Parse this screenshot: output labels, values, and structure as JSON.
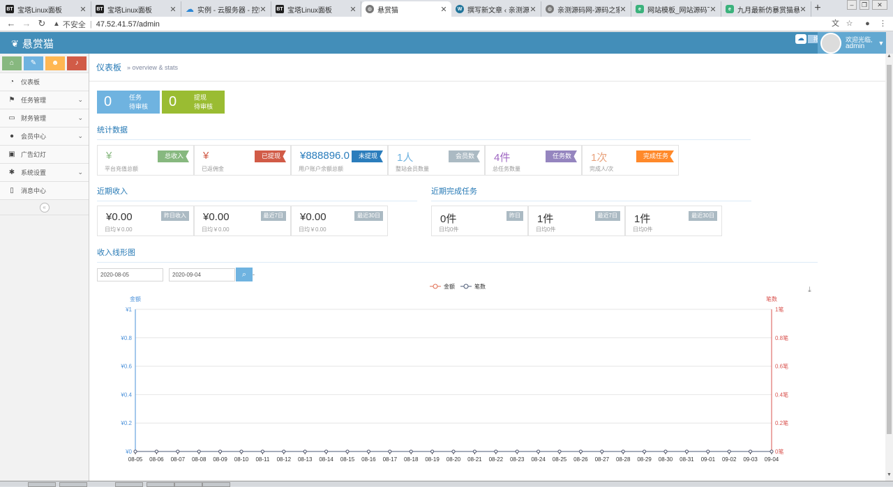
{
  "browser": {
    "tabs": [
      {
        "title": "宝塔Linux面板",
        "icon": "bt-icon"
      },
      {
        "title": "宝塔Linux面板",
        "icon": "bt-icon"
      },
      {
        "title": "实例 - 云服务器 - 控制台",
        "icon": "cloud-icon"
      },
      {
        "title": "宝塔Linux面板",
        "icon": "bt-icon"
      },
      {
        "title": "悬赏猫",
        "icon": "globe-icon"
      },
      {
        "title": "撰写新文章 ‹ 亲测源码网",
        "icon": "wordpress-icon"
      },
      {
        "title": "亲测源码网-源码之家",
        "icon": "globe-icon"
      },
      {
        "title": "网站模板_网站源码下载",
        "icon": "green-icon"
      },
      {
        "title": "九月最新仿暴赏猫悬赏",
        "icon": "green-icon"
      }
    ],
    "active_tab": 4,
    "address": {
      "insecure_label": "不安全",
      "url": "47.52.41.57/admin"
    }
  },
  "header": {
    "logo_text": "悬赏猫",
    "upload_label": "拖拽上传",
    "welcome": "欢迎光临,",
    "username": "admin"
  },
  "sidebar": {
    "shortcuts": [
      {
        "icon": "home-icon",
        "glyph": "⌂",
        "color": "#87b87f"
      },
      {
        "icon": "pencil-icon",
        "glyph": "✎",
        "color": "#6fb3e0"
      },
      {
        "icon": "users-icon",
        "glyph": "☻",
        "color": "#ffb752"
      },
      {
        "icon": "bell-icon",
        "glyph": "♪",
        "color": "#d15b47"
      }
    ],
    "items": [
      {
        "label": "仪表板",
        "icon": "dashboard-icon",
        "glyph": "◔",
        "chevron": false
      },
      {
        "label": "任务管理",
        "icon": "flag-icon",
        "glyph": "⚑",
        "chevron": true
      },
      {
        "label": "财务管理",
        "icon": "wallet-icon",
        "glyph": "▭",
        "chevron": true
      },
      {
        "label": "会员中心",
        "icon": "user-icon",
        "glyph": "●",
        "chevron": true
      },
      {
        "label": "广告幻灯",
        "icon": "picture-icon",
        "glyph": "▣",
        "chevron": false
      },
      {
        "label": "系统设置",
        "icon": "gear-icon",
        "glyph": "✱",
        "chevron": true
      },
      {
        "label": "消息中心",
        "icon": "bookmark-icon",
        "glyph": "▯",
        "chevron": false
      }
    ]
  },
  "breadcrumb": {
    "title": "仪表板",
    "subtitle": "» overview & stats"
  },
  "pending": [
    {
      "count": "0",
      "line1": "任务",
      "line2": "待审核",
      "color": "#6fb3e0"
    },
    {
      "count": "0",
      "line1": "提现",
      "line2": "待审核",
      "color": "#9abc32"
    }
  ],
  "stats": {
    "title": "统计数据",
    "items": [
      {
        "value": "¥",
        "sub": "平台充值总额",
        "tag": "总收入",
        "tag_color": "#87b87f",
        "value_color": "#87b87f"
      },
      {
        "value": "¥",
        "sub": "已返佣金",
        "tag": "已提现",
        "tag_color": "#d15b47",
        "value_color": "#d15b47"
      },
      {
        "value": "¥888896.0",
        "sub": "用户账户余额总额",
        "tag": "未提现",
        "tag_color": "#2b7dbc",
        "value_color": "#2b7dbc"
      },
      {
        "value": "1人",
        "sub": "整站会员数量",
        "tag": "会员数",
        "tag_color": "#abbac3",
        "value_color": "#6fb3e0"
      },
      {
        "value": "4件",
        "sub": "总任务数量",
        "tag": "任务数",
        "tag_color": "#9585bf",
        "value_color": "#a069c3"
      },
      {
        "value": "1次",
        "sub": "完成人/次",
        "tag": "完成任务",
        "tag_color": "#ff892a",
        "value_color": "#e8a27c"
      }
    ]
  },
  "income": {
    "title": "近期收入",
    "cards": [
      {
        "value": "¥0.00",
        "tag": "昨日收入",
        "sub": "日均￥0.00"
      },
      {
        "value": "¥0.00",
        "tag": "最近7日",
        "sub": "日均￥0.00"
      },
      {
        "value": "¥0.00",
        "tag": "最近30日",
        "sub": "日均￥0.00"
      }
    ]
  },
  "tasks": {
    "title": "近期完成任务",
    "cards": [
      {
        "value": "0件",
        "tag": "昨日",
        "sub": "日均0件"
      },
      {
        "value": "1件",
        "tag": "最近7日",
        "sub": "日均0件"
      },
      {
        "value": "1件",
        "tag": "最近30日",
        "sub": "日均0件"
      }
    ]
  },
  "line_chart": {
    "title": "收入线形图",
    "date_from": "2020-08-05",
    "date_sep": "-",
    "date_to": "2020-09-04"
  },
  "chart_data": {
    "type": "line",
    "categories": [
      "08-05",
      "08-06",
      "08-07",
      "08-08",
      "08-09",
      "08-10",
      "08-11",
      "08-12",
      "08-13",
      "08-14",
      "08-15",
      "08-16",
      "08-17",
      "08-18",
      "08-19",
      "08-20",
      "08-21",
      "08-22",
      "08-23",
      "08-24",
      "08-25",
      "08-26",
      "08-27",
      "08-28",
      "08-29",
      "08-30",
      "08-31",
      "09-01",
      "09-02",
      "09-03",
      "09-04"
    ],
    "series": [
      {
        "name": "金额",
        "axis": "left",
        "color": "#e06b4f",
        "values": [
          0,
          0,
          0,
          0,
          0,
          0,
          0,
          0,
          0,
          0,
          0,
          0,
          0,
          0,
          0,
          0,
          0,
          0,
          0,
          0,
          0,
          0,
          0,
          0,
          0,
          0,
          0,
          0,
          0,
          0,
          0
        ]
      },
      {
        "name": "笔数",
        "axis": "right",
        "color": "#4b5a76",
        "values": [
          0,
          0,
          0,
          0,
          0,
          0,
          0,
          0,
          0,
          0,
          0,
          0,
          0,
          0,
          0,
          0,
          0,
          0,
          0,
          0,
          0,
          0,
          0,
          0,
          0,
          0,
          0,
          0,
          0,
          0,
          0
        ]
      }
    ],
    "y_left": {
      "name": "金额",
      "range": [
        0,
        1
      ],
      "ticks": [
        "¥0",
        "¥0.2",
        "¥0.4",
        "¥0.6",
        "¥0.8",
        "¥1"
      ],
      "color": "#4a90d9"
    },
    "y_right": {
      "name": "笔数",
      "range": [
        0,
        1
      ],
      "ticks": [
        "0笔",
        "0.2笔",
        "0.4笔",
        "0.6笔",
        "0.8笔",
        "1笔"
      ],
      "color": "#d9534f"
    },
    "legend": "top-center",
    "grid": true
  }
}
